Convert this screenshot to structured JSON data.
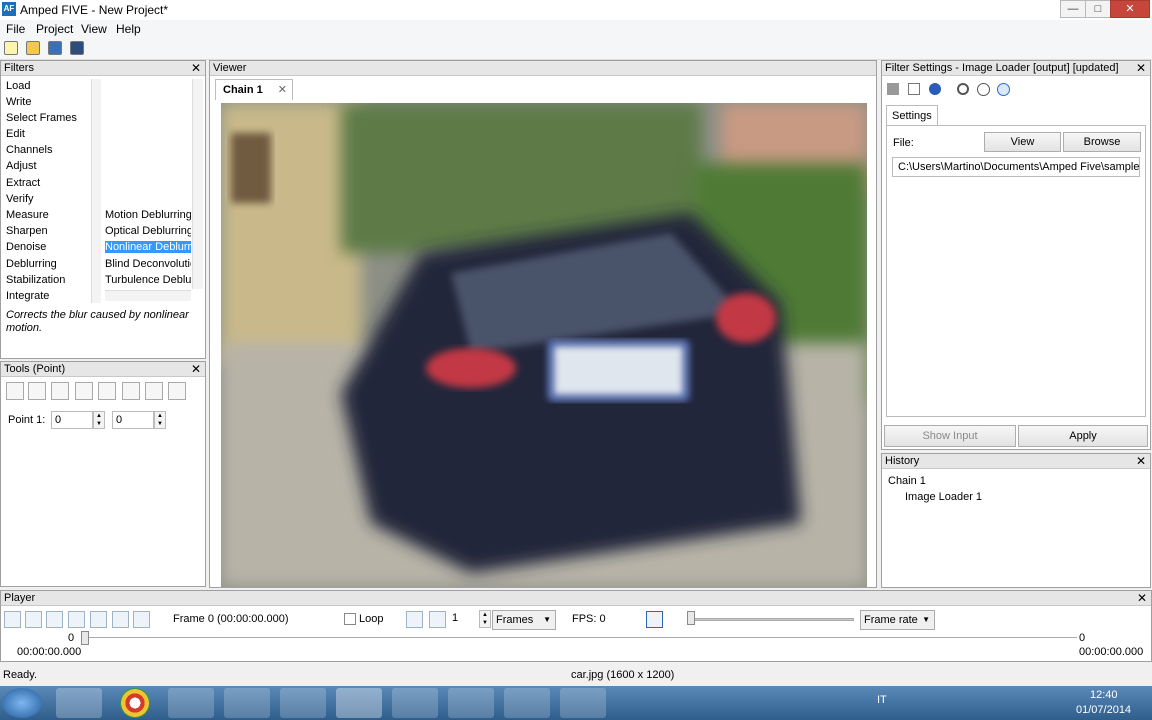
{
  "window": {
    "title": "Amped FIVE - New Project*",
    "icon_text": "AF"
  },
  "window_controls": {
    "minimize": "—",
    "maximize": "□",
    "close": "✕"
  },
  "menu": [
    "File",
    "Project",
    "View",
    "Help"
  ],
  "toolbar": {
    "icons": [
      "new-project-icon",
      "open-icon",
      "save-icon",
      "export-icon"
    ]
  },
  "filters": {
    "title": "Filters",
    "close": "✕",
    "categories": [
      "Load",
      "Write",
      "Select Frames",
      "Edit",
      "Channels",
      "Adjust",
      "Extract",
      "Verify",
      "Measure",
      "Sharpen",
      "Denoise",
      "Deblurring",
      "Stabilization",
      "Integrate"
    ],
    "subfilters": [
      "Motion Deblurring",
      "Optical Deblurring",
      "Nonlinear Deblurring",
      "Blind Deconvolution",
      "Turbulence Deblurring"
    ],
    "selected_subfilter": "Nonlinear Deblurring",
    "description": "Corrects the blur caused by nonlinear motion."
  },
  "tools": {
    "title": "Tools (Point)",
    "close": "✕",
    "point_label": "Point 1:",
    "x": "0",
    "y": "0"
  },
  "viewer": {
    "title": "Viewer",
    "tab": "Chain 1",
    "tab_close": "✕"
  },
  "settings": {
    "title": "Filter Settings - Image Loader [output] [updated]",
    "close": "✕",
    "tab": "Settings",
    "file_label": "File:",
    "view_button": "View",
    "browse_button": "Browse",
    "file_path": "C:\\Users\\Martino\\Documents\\Amped Five\\samples",
    "show_input_button": "Show Input",
    "apply_button": "Apply"
  },
  "history": {
    "title": "History",
    "close": "✕",
    "items": [
      "Chain 1",
      "Image Loader 1"
    ]
  },
  "player": {
    "title": "Player",
    "close": "✕",
    "frame_text": "Frame 0 (00:00:00.000)",
    "loop_label": "Loop",
    "frame_value": "1",
    "unit_select": "Frames",
    "fps": "FPS: 0",
    "rate_select": "Frame rate",
    "start_frame": "0",
    "start_time": "00:00:00.000",
    "end_frame": "0",
    "end_time": "00:00:00.000"
  },
  "status": {
    "left": "Ready.",
    "image_info": "car.jpg (1600 x 1200)"
  },
  "taskbar": {
    "apps": [
      "start-button",
      "file-manager",
      "chrome",
      "clover-app",
      "sublime-text",
      "amped-five-a",
      "amped-five-b",
      "amped-n",
      "pdf-viewer",
      "camtasia-a",
      "camtasia-b"
    ],
    "lang": "IT",
    "time": "12:40",
    "date": "01/07/2014"
  },
  "colors": {
    "selection": "#3399ff",
    "taskbar": "#2f5d8c"
  }
}
